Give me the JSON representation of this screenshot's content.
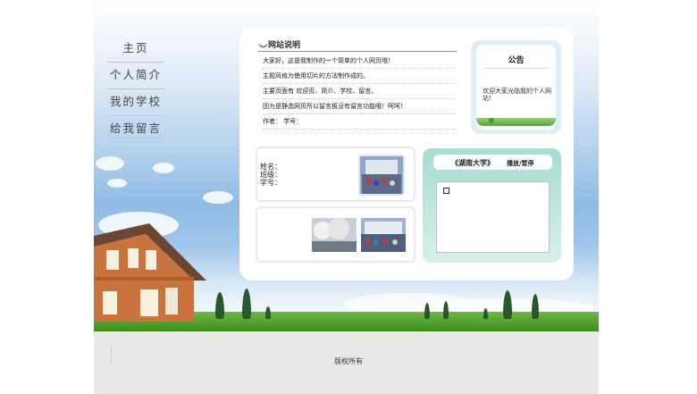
{
  "nav": {
    "items": [
      {
        "label": "主页"
      },
      {
        "label": "个人简介"
      },
      {
        "label": "我的学校"
      },
      {
        "label": "给我留言"
      }
    ]
  },
  "intro": {
    "title": "网站说明",
    "lines": [
      "大家好，这是我制作的一个简单的个人网页哦！",
      "主题风格为使用切片的方法制作成的。",
      "主要页面有 欢迎页、简介、学校、留言。",
      "因为是静态网页所以留言板没有留言功能哦！呵呵！",
      "作者：  学号："
    ]
  },
  "notice": {
    "title": "公告",
    "text": "欢迎大家光临我的个人网站！"
  },
  "profile": {
    "name_label": "姓名：",
    "class_label": "班级：",
    "id_label": "学号："
  },
  "school": {
    "name": "《湖南大学》",
    "play_label": "播放/暂停"
  },
  "footer": {
    "copyright": "版权所有"
  },
  "colors": {
    "panel_bg": "#ffffff",
    "school_gradient_top": "#a7dcd3",
    "footer_bg": "#e9e9e9"
  }
}
